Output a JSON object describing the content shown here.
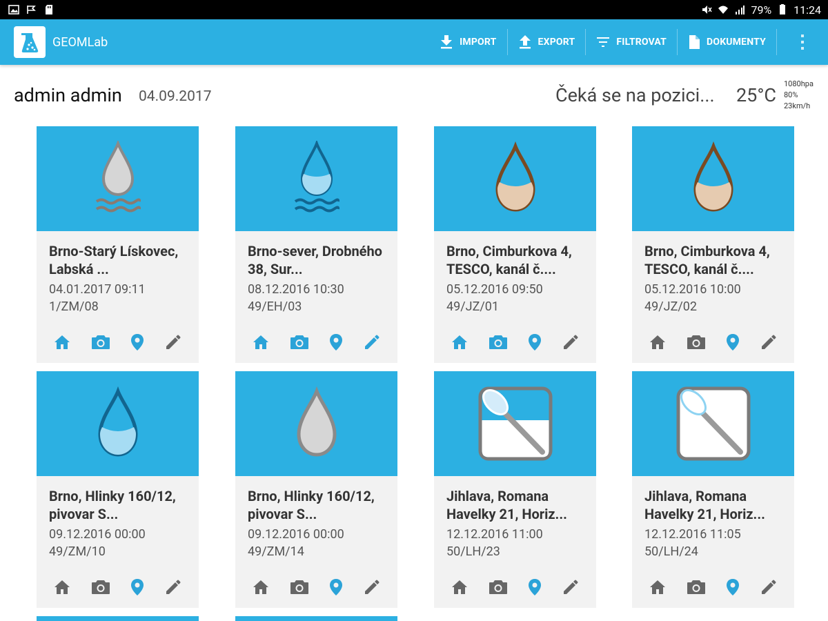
{
  "status_bar": {
    "battery": "79%",
    "time": "11:24"
  },
  "app": {
    "title": "GEOMLab"
  },
  "toolbar": {
    "import_label": "IMPORT",
    "export_label": "EXPORT",
    "filter_label": "FILTROVAT",
    "documents_label": "DOKUMENTY"
  },
  "header": {
    "user": "admin admin",
    "date": "04.09.2017",
    "position_status": "Čeká se na pozici...",
    "temperature": "25°C",
    "pressure": "1080hpa",
    "humidity": "80%",
    "wind": "23km/h"
  },
  "cards": [
    {
      "title": "Brno-Starý Lískovec, Labská ...",
      "datetime": "04.01.2017 09:11",
      "code": "1/ZM/08",
      "image": "gray-drop-waves-icon"
    },
    {
      "title": "Brno-sever, Drobného 38, Sur...",
      "datetime": "08.12.2016 10:30",
      "code": "49/EH/03",
      "image": "blue-drop-waves-icon"
    },
    {
      "title": "Brno, Cimburkova 4, TESCO, kanál č....",
      "datetime": "05.12.2016 09:50",
      "code": "49/JZ/01",
      "image": "brown-drop-icon"
    },
    {
      "title": "Brno, Cimburkova 4, TESCO, kanál č....",
      "datetime": "05.12.2016 10:00",
      "code": "49/JZ/02",
      "image": "brown-drop-icon"
    },
    {
      "title": "Brno, Hlinky 160/12, pivovar S...",
      "datetime": "09.12.2016 00:00",
      "code": "49/ZM/10",
      "image": "blue-drop-icon"
    },
    {
      "title": "Brno, Hlinky 160/12, pivovar S...",
      "datetime": "09.12.2016 00:00",
      "code": "49/ZM/14",
      "image": "gray-drop-icon"
    },
    {
      "title": "Jihlava, Romana Havelky 21, Horiz...",
      "datetime": "12.12.2016 11:00",
      "code": "50/LH/23",
      "image": "sampling-spoon-half-icon"
    },
    {
      "title": "Jihlava, Romana Havelky 21, Horiz...",
      "datetime": "12.12.2016 11:05",
      "code": "50/LH/24",
      "image": "sampling-spoon-icon"
    }
  ],
  "colors": {
    "primary": "#2cb0e2",
    "active_icon": "#2ba3d8",
    "inactive_icon": "#666666",
    "card_bg": "#f2f2f2"
  }
}
